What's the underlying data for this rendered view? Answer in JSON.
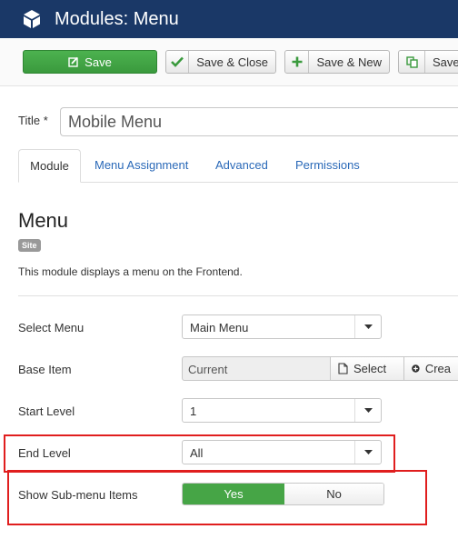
{
  "header": {
    "title": "Modules: Menu",
    "logo_icon": "joomla-cube-icon",
    "bg_color": "#1a3867"
  },
  "toolbar": {
    "save": "Save",
    "save_close": "Save & Close",
    "save_new": "Save & New",
    "save_copy": "Save"
  },
  "title_field": {
    "label": "Title *",
    "value": "Mobile Menu"
  },
  "tabs": [
    "Module",
    "Menu Assignment",
    "Advanced",
    "Permissions"
  ],
  "module_info": {
    "heading": "Menu",
    "badge": "Site",
    "description": "This module displays a menu on the Frontend."
  },
  "fields": {
    "select_menu": {
      "label": "Select Menu",
      "value": "Main Menu"
    },
    "base_item": {
      "label": "Base Item",
      "value": "Current",
      "select_label": "Select",
      "create_label": "Crea"
    },
    "start_level": {
      "label": "Start Level",
      "value": "1"
    },
    "end_level": {
      "label": "End Level",
      "value": "All"
    },
    "show_submenu": {
      "label": "Show Sub-menu Items",
      "yes": "Yes",
      "no": "No",
      "selected": "Yes"
    }
  },
  "highlight_color": "#e01e1e"
}
